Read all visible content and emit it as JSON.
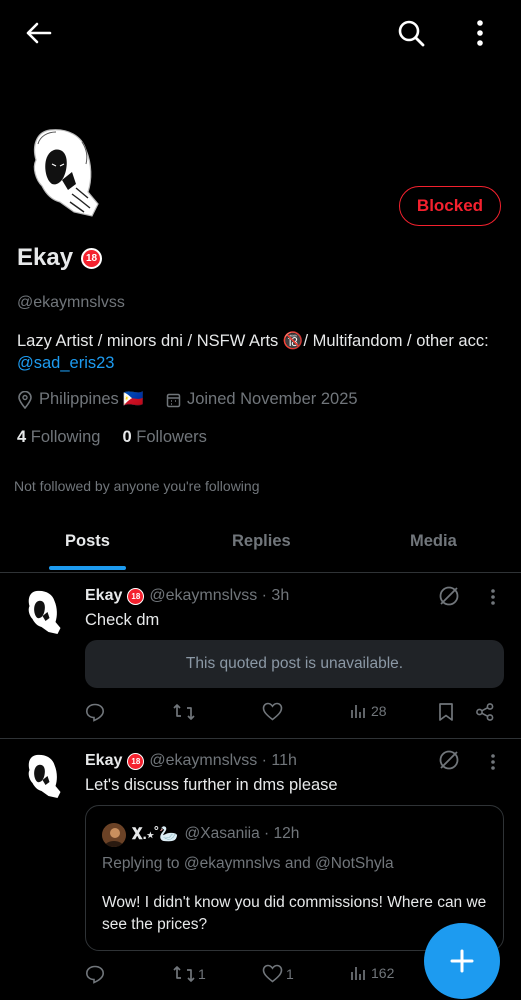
{
  "profile": {
    "name": "Ekay",
    "badge": "18",
    "handle": "@ekaymnslvss",
    "blocked_label": "Blocked",
    "bio_text": "Lazy Artist / minors dni / NSFW Arts 🔞/ Multifandom / other acc: ",
    "bio_link": "@sad_eris23",
    "location": "Philippines 🇵🇭",
    "joined": "Joined November 2025",
    "following_count": "4",
    "following_label": "Following",
    "followers_count": "0",
    "followers_label": "Followers",
    "not_followed": "Not followed by anyone you're following"
  },
  "tabs": [
    "Posts",
    "Replies",
    "Media"
  ],
  "posts": [
    {
      "name": "Ekay",
      "handle_time": "@ekaymnslvss · 3h",
      "text": "Check dm",
      "quote_unavailable": "This quoted post is unavailable.",
      "views": "28"
    },
    {
      "name": "Ekay",
      "handle_time": "@ekaymnslvss · 11h",
      "text": "Let's discuss further in dms please",
      "quote": {
        "name": "𝐗.⋆˚🦢",
        "handle_time": "@Xasaniia · 12h",
        "replying": "Replying to @ekaymnslvs and @NotShyla",
        "text": "Wow! I didn't know you did commissions! Where can we see the prices?"
      },
      "retweets": "1",
      "likes": "1",
      "views": "162"
    }
  ],
  "colors": {
    "accent": "#1d9bf0",
    "blocked": "#f4212e",
    "muted": "#71767b"
  }
}
